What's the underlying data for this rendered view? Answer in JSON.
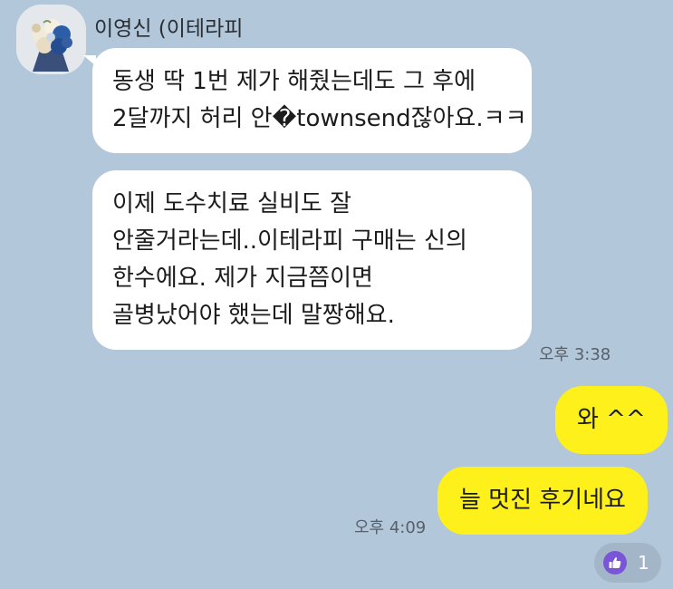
{
  "chat": {
    "sender": {
      "name": "이영신 (이테라피"
    },
    "messages": [
      {
        "lines": [
          "동생 딱 1번 제가 해줬는데도 그 후에",
          "2달까지 허리 안�townsend잖아요.ㅋㅋ"
        ]
      },
      {
        "lines": [
          "이제 도수치료 실비도 잘",
          "안줄거라는데..이테라피 구매는 신의",
          "한수에요. 제가 지금쯤이면",
          "골병났어야 했는데 말짱해요."
        ],
        "time": "오후 3:38"
      },
      {
        "text": "와 ^^"
      },
      {
        "text": "늘 멋진 후기네요",
        "time": "오후 4:09"
      }
    ],
    "reaction": {
      "icon": "thumbs-up-icon",
      "count": "1"
    }
  },
  "colors": {
    "background": "#b2c7d9",
    "incoming_bubble": "#ffffff",
    "outgoing_bubble": "#fef01b",
    "reaction_accent": "#7a55d7"
  }
}
